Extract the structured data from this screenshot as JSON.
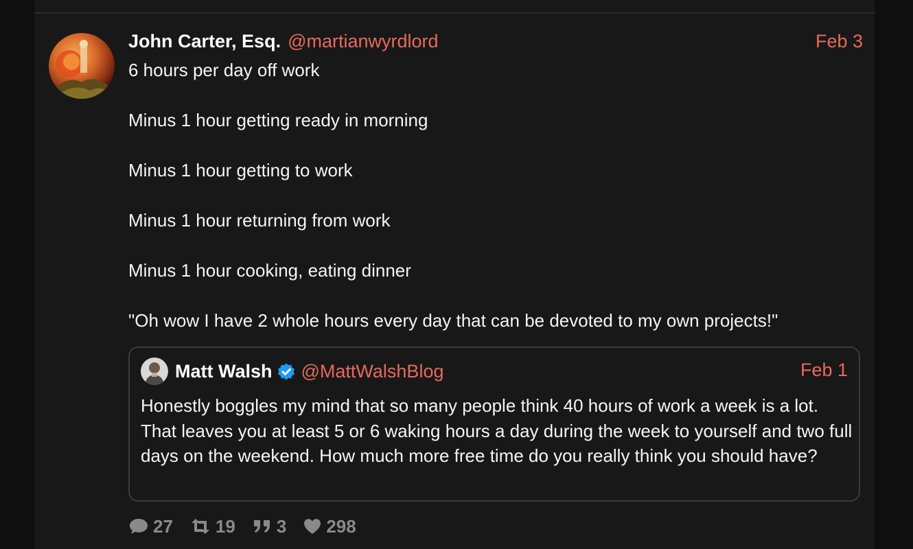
{
  "tweet": {
    "author": {
      "name": "John Carter, Esq.",
      "handle": "@martianwyrdlord"
    },
    "date": "Feb 3",
    "lines": [
      "6 hours per day off work",
      "Minus 1 hour getting ready in morning",
      "Minus 1 hour getting to work",
      "Minus 1 hour returning from work",
      "Minus 1 hour cooking, eating dinner",
      "\"Oh wow I have 2 whole hours every day that can be devoted to my own projects!\""
    ],
    "quote": {
      "author": {
        "name": "Matt Walsh",
        "handle": "@MattWalshBlog",
        "verified": true
      },
      "date": "Feb 1",
      "text": "Honestly boggles my mind that so many people think 40 hours of work a week is a lot. That leaves you at least 5 or 6 waking hours a day during the week to yourself and two full days on the weekend. How much more free time do you really think you should have?"
    },
    "stats": {
      "replies": "27",
      "retweets": "19",
      "quotes": "3",
      "likes": "298"
    }
  },
  "colors": {
    "accent": "#e8695c",
    "verified": "#1d9bf0",
    "muted": "#8a8a8a",
    "background": "#181818"
  }
}
